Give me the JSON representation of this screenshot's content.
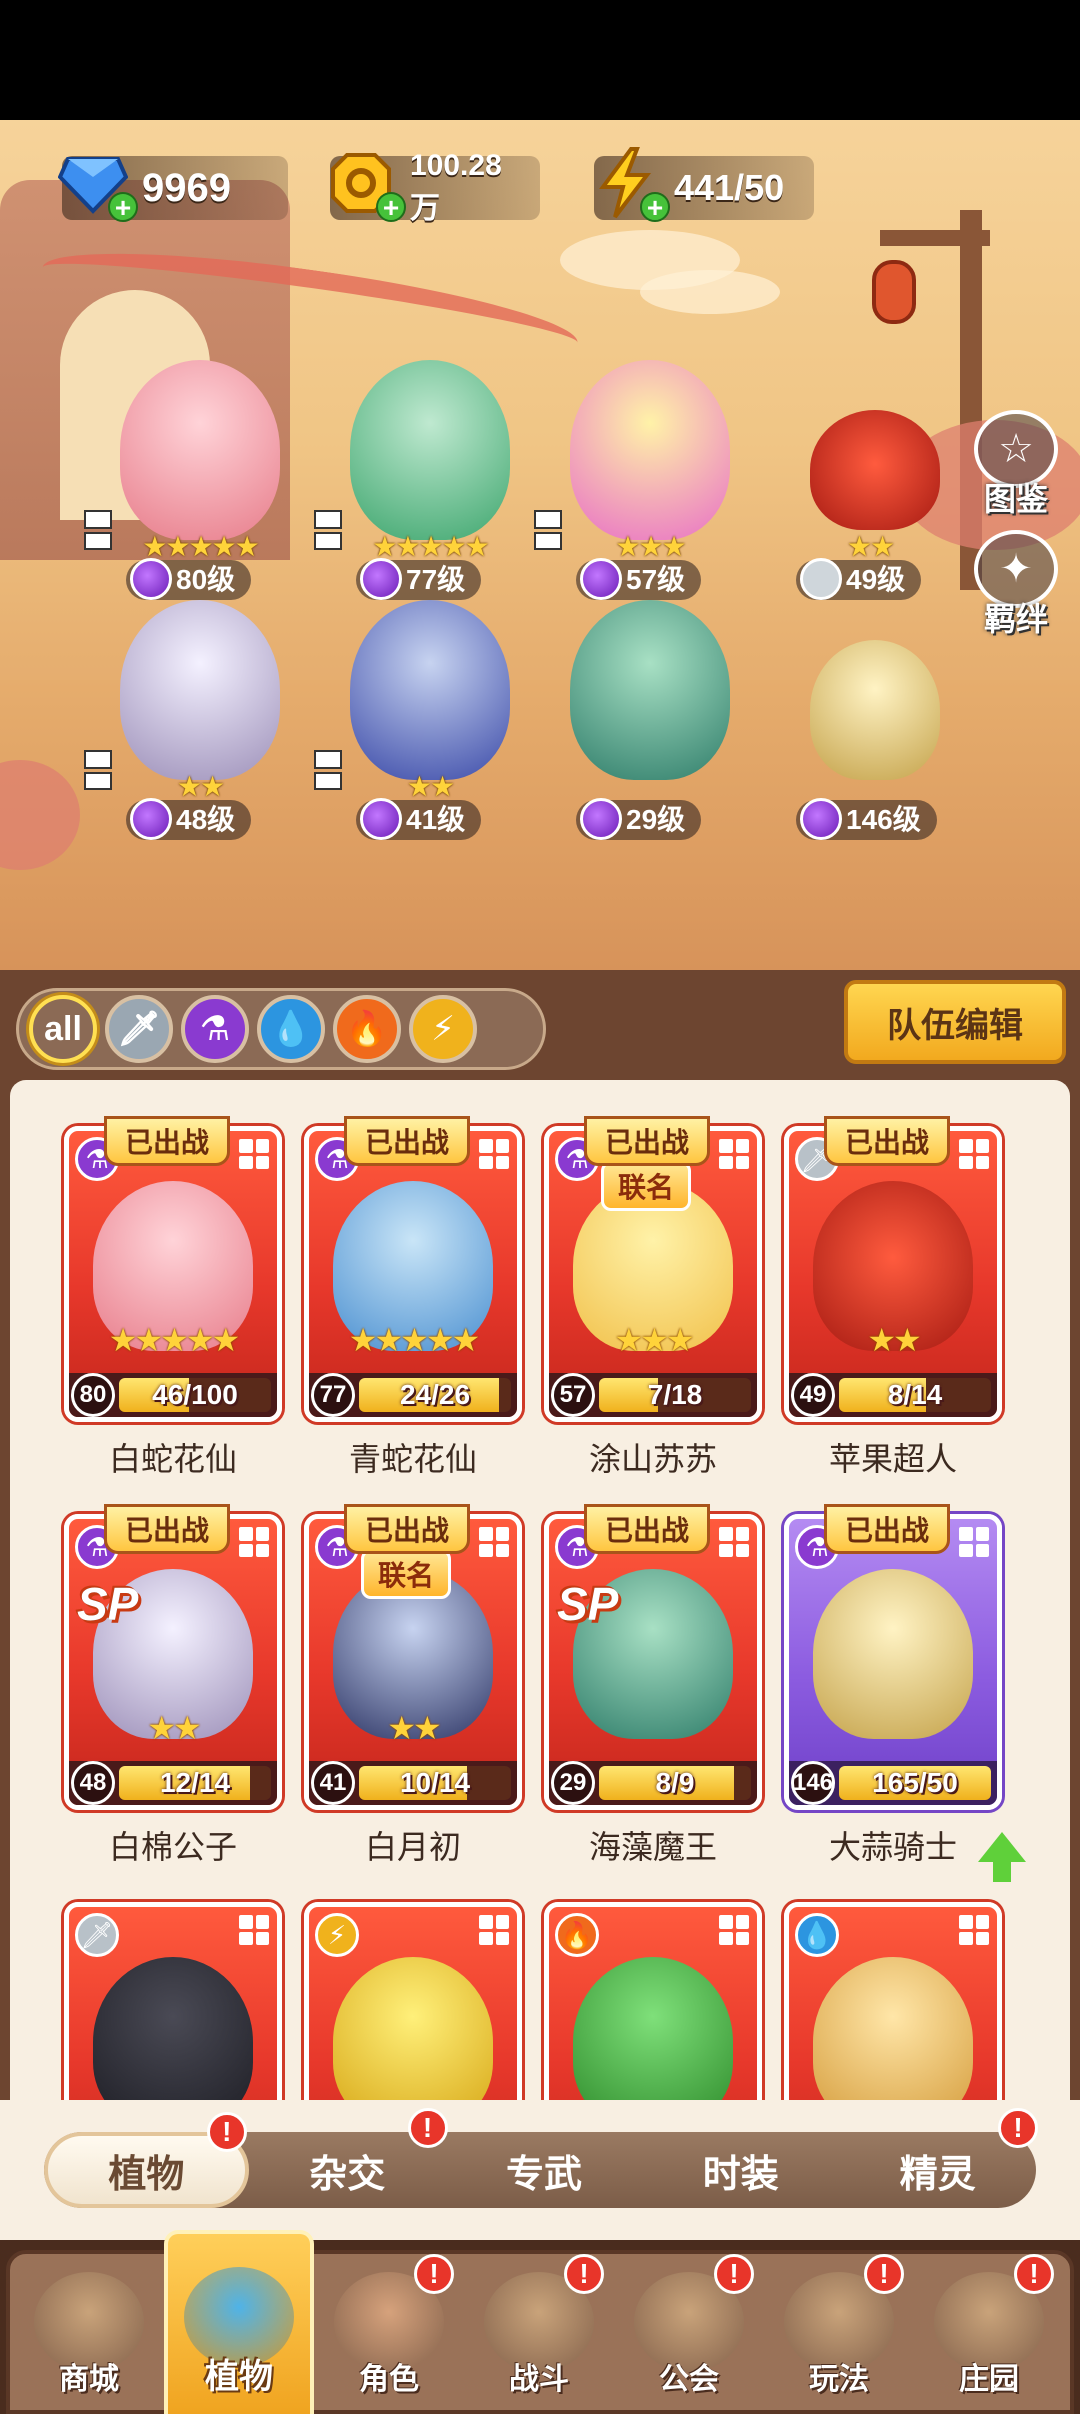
{
  "resources": {
    "gems": "9969",
    "coins": "100.28万",
    "energy": "441/50"
  },
  "side_buttons": {
    "codex": "图鉴",
    "bonds": "羁绊"
  },
  "formation": [
    {
      "level": "80级",
      "stars": 5
    },
    {
      "level": "77级",
      "stars": 5
    },
    {
      "level": "57级",
      "stars": 3
    },
    {
      "level": "49级",
      "stars": 2
    },
    {
      "level": "48级",
      "stars": 2
    },
    {
      "level": "41级",
      "stars": 2
    },
    {
      "level": "29级",
      "stars": 0
    },
    {
      "level": "146级",
      "stars": 0
    }
  ],
  "filters": {
    "all_label": "all",
    "items": [
      "all",
      "sword",
      "potion",
      "water",
      "fire",
      "lightning"
    ],
    "team_edit": "队伍编辑"
  },
  "cards": [
    {
      "name": "白蛇花仙",
      "level": "80",
      "progress": "46/100",
      "fill": 0.46,
      "stars": 5,
      "deployed": "已出战",
      "rarity": "red",
      "type": "potion",
      "sp": false,
      "collab": ""
    },
    {
      "name": "青蛇花仙",
      "level": "77",
      "progress": "24/26",
      "fill": 0.92,
      "stars": 5,
      "deployed": "已出战",
      "rarity": "red",
      "type": "potion",
      "sp": false,
      "collab": ""
    },
    {
      "name": "涂山苏苏",
      "level": "57",
      "progress": "7/18",
      "fill": 0.39,
      "stars": 3,
      "deployed": "已出战",
      "rarity": "red",
      "type": "potion",
      "sp": false,
      "collab": "联名"
    },
    {
      "name": "苹果超人",
      "level": "49",
      "progress": "8/14",
      "fill": 0.57,
      "stars": 2,
      "deployed": "已出战",
      "rarity": "red",
      "type": "sword",
      "sp": false,
      "collab": ""
    },
    {
      "name": "白棉公子",
      "level": "48",
      "progress": "12/14",
      "fill": 0.86,
      "stars": 2,
      "deployed": "已出战",
      "rarity": "red",
      "type": "potion",
      "sp": true,
      "sp_label": "SP",
      "collab": ""
    },
    {
      "name": "白月初",
      "level": "41",
      "progress": "10/14",
      "fill": 0.71,
      "stars": 2,
      "deployed": "已出战",
      "rarity": "red",
      "type": "potion",
      "sp": false,
      "collab": "联名"
    },
    {
      "name": "海藻魔王",
      "level": "29",
      "progress": "8/9",
      "fill": 0.89,
      "stars": 0,
      "deployed": "已出战",
      "rarity": "red",
      "type": "potion",
      "sp": true,
      "sp_label": "SP",
      "collab": ""
    },
    {
      "name": "大蒜骑士",
      "level": "146",
      "progress": "165/50",
      "fill": 1.0,
      "stars": 0,
      "deployed": "已出战",
      "rarity": "purple",
      "type": "potion",
      "sp": false,
      "collab": "",
      "upgrade": true
    },
    {
      "name": "",
      "type": "sword"
    },
    {
      "name": "",
      "type": "lightning"
    },
    {
      "name": "",
      "type": "fire"
    },
    {
      "name": "",
      "type": "water"
    }
  ],
  "sub_tabs": [
    {
      "label": "植物",
      "badge": "!",
      "active": true
    },
    {
      "label": "杂交",
      "badge": "!"
    },
    {
      "label": "专武",
      "badge": ""
    },
    {
      "label": "时装",
      "badge": ""
    },
    {
      "label": "精灵",
      "badge": "!"
    }
  ],
  "nav": [
    {
      "label": "商城",
      "badge": ""
    },
    {
      "label": "植物",
      "badge": "",
      "active": true
    },
    {
      "label": "角色",
      "badge": "!"
    },
    {
      "label": "战斗",
      "badge": "!"
    },
    {
      "label": "公会",
      "badge": "!"
    },
    {
      "label": "玩法",
      "badge": "!"
    },
    {
      "label": "庄园",
      "badge": "!"
    }
  ],
  "colors": {
    "card_red": "#e7382b",
    "card_purple": "#8c5ce0",
    "gold": "#ffc640",
    "panel_bg": "#f8efe2"
  }
}
